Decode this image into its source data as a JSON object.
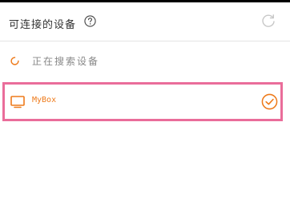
{
  "header": {
    "title": "可连接的设备",
    "help_icon": "question-circle-icon",
    "refresh_icon": "refresh-icon"
  },
  "searching": {
    "text": "正在搜索设备",
    "icon": "spinner-icon"
  },
  "devices": [
    {
      "name": "MyBox",
      "icon": "tv-icon",
      "selected": true,
      "status_icon": "check-circle-icon"
    }
  ],
  "colors": {
    "accent": "#ee7a1a",
    "highlight_border": "#ea6d9a",
    "title_text": "#333333",
    "muted_text": "#888888",
    "refresh_icon": "#c8c8c8"
  }
}
